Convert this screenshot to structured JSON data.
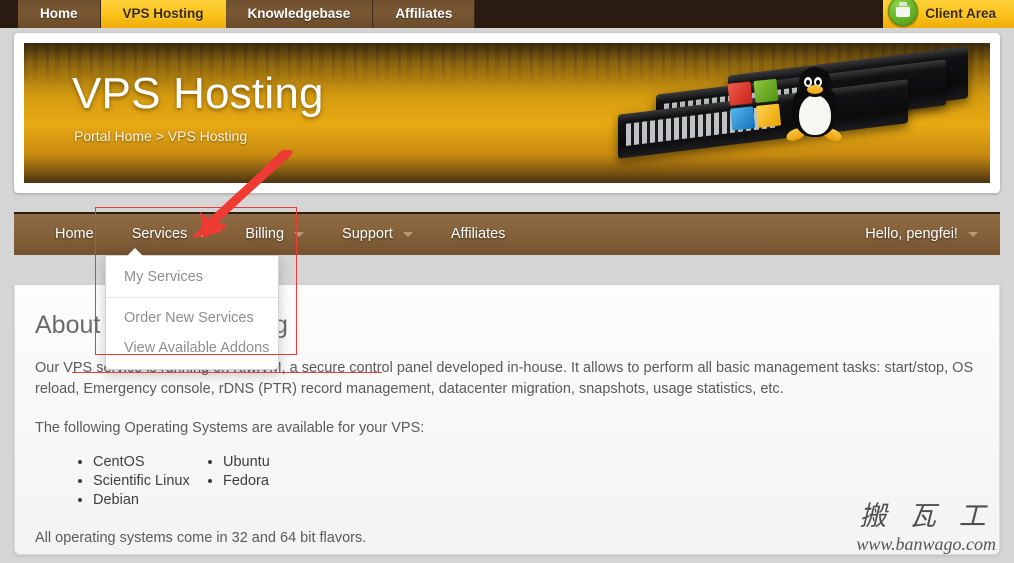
{
  "topbar": {
    "tabs": [
      {
        "label": "Home",
        "active": false
      },
      {
        "label": "VPS Hosting",
        "active": true
      },
      {
        "label": "Knowledgebase",
        "active": false
      },
      {
        "label": "Affiliates",
        "active": false
      }
    ],
    "client_area_label": "Client Area",
    "cart_icon": "green-clipboard-icon"
  },
  "banner": {
    "title": "VPS Hosting",
    "breadcrumb": "Portal Home > VPS Hosting",
    "artwork": "rack-servers-with-windows-and-linux-logos",
    "gradient_from": "#d59b10",
    "gradient_to": "#e8aa13"
  },
  "nav": {
    "items": [
      {
        "label": "Home",
        "has_caret": false,
        "caret_active": false
      },
      {
        "label": "Services",
        "has_caret": true,
        "caret_active": true
      },
      {
        "label": "Billing",
        "has_caret": true,
        "caret_active": false
      },
      {
        "label": "Support",
        "has_caret": true,
        "caret_active": false
      },
      {
        "label": "Affiliates",
        "has_caret": false,
        "caret_active": false
      }
    ],
    "user_greeting": "Hello, pengfei!",
    "bar_color": "#84613a"
  },
  "dropdown": {
    "open_for": "Services",
    "items": [
      {
        "label": "My Services"
      },
      {
        "label": "Order New Services"
      },
      {
        "label": "View Available Addons"
      }
    ]
  },
  "content": {
    "heading": "About our VPS hosting",
    "paragraph1": "Our VPS service is running on KiwiVM, a secure control panel developed in-house. It allows to perform all basic management tasks: start/stop, OS reload, Emergency console, rDNS (PTR) record management, datacenter migration, snapshots, usage statistics, etc.",
    "paragraph2": "The following Operating Systems are available for your VPS:",
    "os_column_1": [
      "CentOS",
      "Scientific Linux",
      "Debian"
    ],
    "os_column_2": [
      "Ubuntu",
      "Fedora"
    ],
    "paragraph3": "All operating systems come in 32 and 64 bit flavors."
  },
  "annotations": {
    "highlight_color": "#ee3b33",
    "box_target": "services-dropdown",
    "arrow_target": "services-menu",
    "strikethrough_text": "service is running on KiwiVM, a s"
  },
  "watermark": {
    "chinese": "搬 瓦 工",
    "url": "www.banwago.com"
  }
}
